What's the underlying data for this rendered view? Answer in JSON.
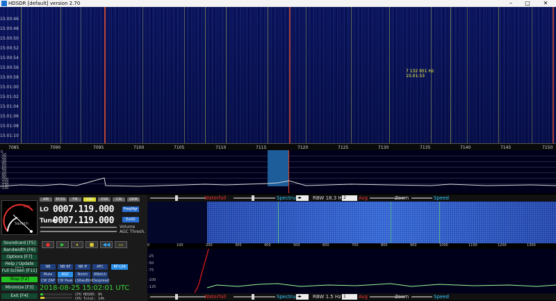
{
  "window": {
    "title": "HDSDR [default] version 2.70",
    "controls": [
      "–",
      "□",
      "✕"
    ]
  },
  "waterfall_top": {
    "timestamps": [
      "15:00:46",
      "15:00:48",
      "15:00:50",
      "15:00:52",
      "15:00:54",
      "15:00:56",
      "15:00:58",
      "15:01:00",
      "15:01:02",
      "15:01:04",
      "15:01:06",
      "15:01:08",
      "15:01:10"
    ],
    "annotation_freq": "7 132 951 Hz",
    "annotation_time": "15:01:53",
    "colors": {
      "background": "#0b1660",
      "signal": "#d6d63a",
      "strong": "#e04020"
    }
  },
  "freq_scale": {
    "ticks": [
      "7085",
      "7090",
      "7095",
      "7100",
      "7105",
      "7110",
      "7115",
      "7120",
      "7125",
      "7130",
      "7135",
      "7140",
      "7145",
      "7150"
    ]
  },
  "spectrum_top": {
    "db_ticks": [
      "0",
      "-10",
      "-20",
      "-30",
      "-40",
      "-50",
      "-60",
      "-70",
      "-80",
      "-90",
      "-100",
      "-110",
      "-120",
      "-130"
    ]
  },
  "bar_top": {
    "waterfall": "Waterfall",
    "spectrum": "Spectrum",
    "rbw": "RBW 18.3 Hz",
    "avg_value": "2",
    "avg": "Avg",
    "zoom": "Zoom",
    "speed": "Speed"
  },
  "bar_bot": {
    "waterfall": "Waterfall",
    "spectrum": "Spectrum",
    "rbw": "RBW 1.5 Hz",
    "avg_value": "1",
    "avg": "Avg",
    "zoom": "Zoom",
    "speed": "Speed"
  },
  "smeter": {
    "scale": [
      "1",
      "3",
      "5",
      "7",
      "9",
      "+20",
      "+40",
      "+60"
    ],
    "label": "Squelch"
  },
  "mode_buttons": [
    "AM",
    "ECSS",
    "FM",
    "LSB",
    "USB",
    "CW",
    "DRM"
  ],
  "lo": {
    "label": "LO",
    "value": "0007.119.000",
    "button": "FreqMgr"
  },
  "tune": {
    "label": "Tune",
    "value": "0007.119.000",
    "button": "ExtIO"
  },
  "volume_label": "Volume",
  "agc_label": "AGC Thresh.",
  "playback": [
    "●",
    "▶",
    "⏸",
    "■",
    "◀◀",
    "▭"
  ],
  "side_buttons": [
    {
      "label": "Soundcard [F5]"
    },
    {
      "label": "Bandwidth [F6]"
    },
    {
      "label": "Options [F7]"
    },
    {
      "label": "Help / Update [F1]"
    },
    {
      "label": "Full Screen [F11]"
    },
    {
      "label": "Stop [F2]"
    },
    {
      "label": "Minimize [F3]"
    },
    {
      "label": "Exit [F4]"
    }
  ],
  "dsp_row1": [
    "NB",
    "NB RF",
    "NB IF",
    "AFC",
    "RF<24"
  ],
  "dsp_row2": [
    "Mute",
    "AGC Slow",
    "Notch",
    "ANotch"
  ],
  "dsp_row3": [
    "CW ZAP",
    "CW Peak",
    "LSRauBlnt",
    "Despread"
  ],
  "datetime": "2018-08-25  15:02:01 UTC",
  "cpu": {
    "line1": "CPU HDSDR: 8%",
    "line2": "CPU Total: 14%"
  },
  "bottom_scale": {
    "ticks": [
      "0",
      "100",
      "200",
      "300",
      "400",
      "500",
      "600",
      "700",
      "800",
      "900",
      "1000",
      "1100",
      "1200",
      "1300"
    ]
  },
  "bottom_db": [
    "-25",
    "-50",
    "-75",
    "-100",
    "-125"
  ]
}
